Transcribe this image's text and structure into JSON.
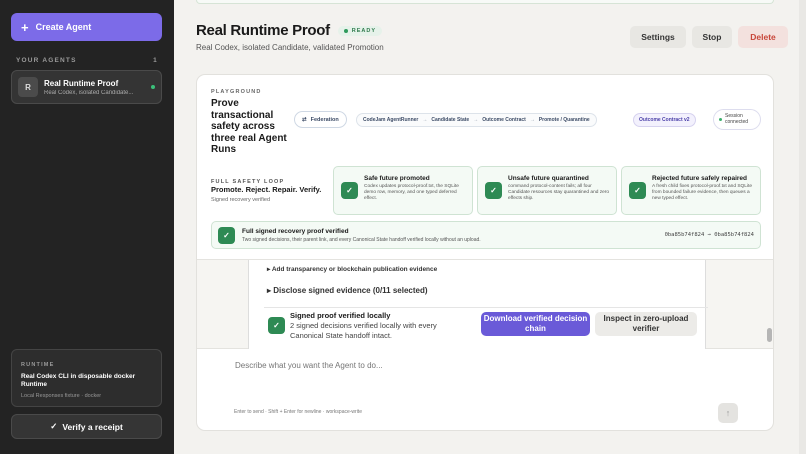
{
  "sidebar": {
    "create_agent_label": "Create Agent",
    "agents_heading": "YOUR AGENTS",
    "agents_count": "1",
    "agents": [
      {
        "avatar": "R",
        "name": "Real Runtime Proof",
        "subtitle": "Real Codex, isolated Candidate..."
      }
    ],
    "runtime": {
      "label": "RUNTIME",
      "title": "Real Codex CLI in disposable docker Runtime",
      "subtitle": "Local Responses fixture · docker"
    },
    "verify_label": "Verify a receipt"
  },
  "header": {
    "title": "Real Runtime Proof",
    "status": "READY",
    "subtitle": "Real Codex, isolated Candidate, validated Promotion",
    "actions": {
      "settings": "Settings",
      "stop": "Stop",
      "delete": "Delete"
    }
  },
  "playground": {
    "label": "PLAYGROUND",
    "title": "Prove transactional safety across three real Agent Runs",
    "federation": "Federation",
    "flow": [
      "CodeJam AgentRunner",
      "Candidate State",
      "Outcome Contract",
      "Promote / Quarantine"
    ],
    "contract": "Outcome Contract v2",
    "session": "Session connected",
    "loop": {
      "label": "FULL SAFETY LOOP",
      "title": "Promote. Reject. Repair. Verify.",
      "subtitle": "Signed recovery verified"
    },
    "cards": [
      {
        "title": "Safe future promoted",
        "desc": "Codex updates protocol-proof.txt, the SQLite demo row, memory, and one typed deferred effect."
      },
      {
        "title": "Unsafe future quarantined",
        "desc": "command protocol-content fails; all four Candidate resources stay quarantined and zero effects ship."
      },
      {
        "title": "Rejected future safely repaired",
        "desc": "A fresh child fixes protocol-proof.txt and SQLite from bounded failure evidence, then queues a new typed effect."
      }
    ],
    "full_proof": {
      "title": "Full signed recovery proof verified",
      "desc": "Two signed decisions, their parent link, and every Canonical State handoff verified locally without an upload.",
      "hash_from": "0ba85b74f824",
      "hash_to": "0ba85b74f824"
    }
  },
  "evidence": {
    "transparency": "▸ Add transparency or blockchain publication evidence",
    "disclose": "▸ Disclose signed evidence (0/11 selected)",
    "proof_title": "Signed proof verified locally",
    "proof_desc": "2 signed decisions verified locally with every Canonical State handoff intact.",
    "download_label": "Download verified decision chain",
    "inspect_label": "Inspect in zero-upload verifier"
  },
  "composer": {
    "placeholder": "Describe what you want the Agent to do...",
    "hint": "Enter to send · Shift + Enter for newline · workspace-write"
  },
  "colors": {
    "accent": "#7c6be8",
    "success": "#2e8a54",
    "danger": "#c8463a",
    "sidebar_bg": "#232323"
  }
}
